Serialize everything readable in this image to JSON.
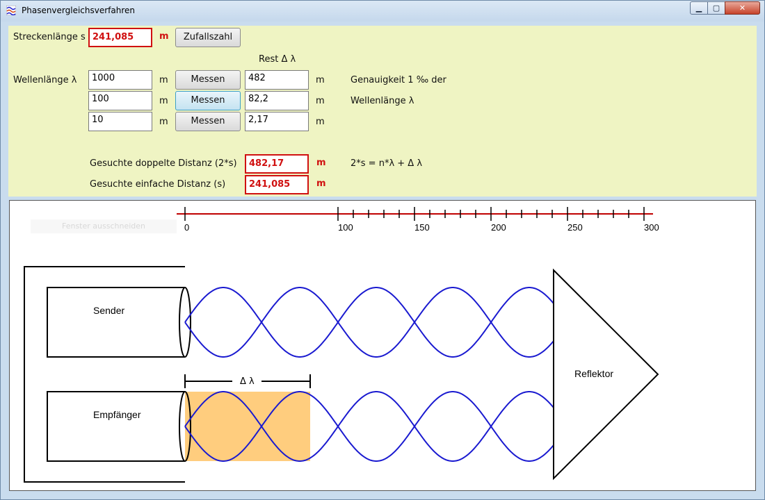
{
  "window": {
    "title": "Phasenvergleichsverfahren"
  },
  "controls": {
    "strecke_label": "Streckenlänge s",
    "strecke_value": "241,085",
    "strecke_unit": "m",
    "zufall_label": "Zufallszahl",
    "rest_header": "Rest  Δ λ",
    "wellen_label": "Wellenlänge λ",
    "rows": [
      {
        "lambda": "1000",
        "unit": "m",
        "messen": "Messen",
        "rest": "482",
        "rest_unit": "m"
      },
      {
        "lambda": "100",
        "unit": "m",
        "messen": "Messen",
        "rest": "82,2",
        "rest_unit": "m"
      },
      {
        "lambda": "10",
        "unit": "m",
        "messen": "Messen",
        "rest": "2,17",
        "rest_unit": "m"
      }
    ],
    "genauigkeit_line1": "Genauigkeit 1 ‰ der",
    "genauigkeit_line2": "Wellenlänge λ",
    "doppelt_label": "Gesuchte doppelte Distanz (2*s)",
    "doppelt_value": "482,17",
    "doppelt_unit": "m",
    "formula": "2*s = n*λ + Δ λ",
    "einfach_label": "Gesuchte einfache Distanz (s)",
    "einfach_value": "241,085",
    "einfach_unit": "m"
  },
  "diagram": {
    "ghost_button": "Fenster ausschneiden",
    "scale_labels": [
      "0",
      "100",
      "150",
      "200",
      "250",
      "300"
    ],
    "sender": "Sender",
    "empfaenger": "Empfänger",
    "reflektor": "Reflektor",
    "delta_lambda": "Δ λ",
    "colors": {
      "wave": "#1a1ad0",
      "scale": "#c00000",
      "highlight": "#ffc870"
    }
  }
}
